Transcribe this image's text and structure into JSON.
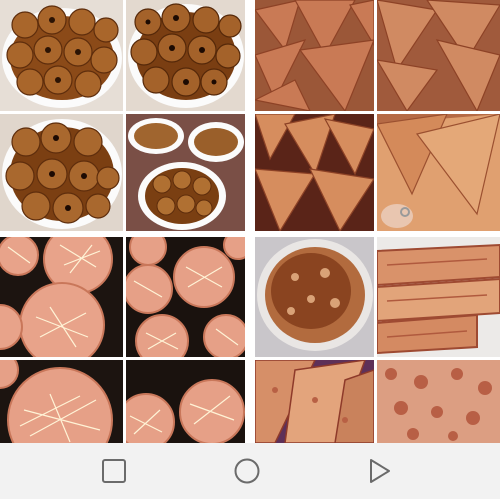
{
  "gallery": {
    "tiles": [
      {
        "icon": "food-photo",
        "subject": "cookies"
      },
      {
        "icon": "food-photo",
        "subject": "cookies"
      },
      {
        "icon": "food-photo",
        "subject": "samosas"
      },
      {
        "icon": "food-photo",
        "subject": "samosas"
      },
      {
        "icon": "food-photo",
        "subject": "cookies"
      },
      {
        "icon": "food-photo",
        "subject": "cookies"
      },
      {
        "icon": "food-photo",
        "subject": "samosas"
      },
      {
        "icon": "food-photo",
        "subject": "samosas"
      },
      {
        "icon": "food-photo",
        "subject": "cheese-pastries"
      },
      {
        "icon": "food-photo",
        "subject": "cheese-pastries"
      },
      {
        "icon": "food-photo",
        "subject": "flatbread"
      },
      {
        "icon": "food-photo",
        "subject": "layered-pastry"
      },
      {
        "icon": "food-photo",
        "subject": "cheese-pastries"
      },
      {
        "icon": "food-photo",
        "subject": "cheese-pastries"
      },
      {
        "icon": "food-photo",
        "subject": "layered-pastry"
      },
      {
        "icon": "food-photo",
        "subject": "flatbread"
      }
    ]
  },
  "navigation_bar": {
    "buttons": [
      {
        "icon": "square-recents-icon"
      },
      {
        "icon": "circle-home-icon"
      },
      {
        "icon": "triangle-back-icon"
      }
    ],
    "color": "#6b6b6b"
  },
  "colors": {
    "background": "#ffffff",
    "navbar": "#f2f2f2"
  }
}
